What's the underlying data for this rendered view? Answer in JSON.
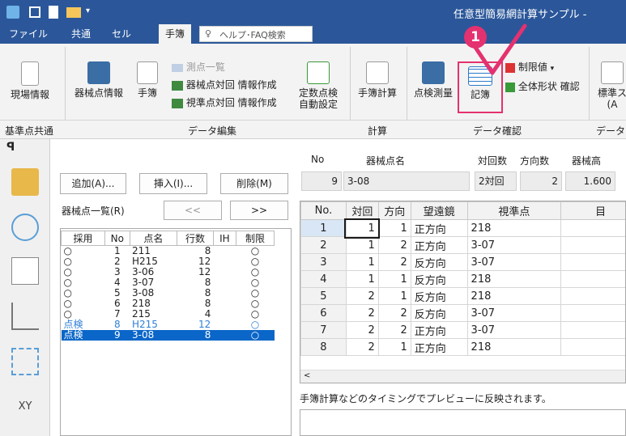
{
  "title": "任意型簡易網計算サンプル -",
  "tabs": [
    "ファイル",
    "共通",
    "セル",
    "手簿"
  ],
  "help_search": "ヘルプ･FAQ検索",
  "ribbon": {
    "genba": "現場情報",
    "kikaiten_info": "器械点情報",
    "tebo_menu": "手簿",
    "sokuten_list": "測点一覧",
    "kikai_taikai": "器械点対回 情報作成",
    "shijun_taikai": "視準点対回 情報作成",
    "teisu": "定数点検",
    "jido": "自動設定",
    "tebo_keisan": "手簿計算",
    "tenken_sokuryo": "点検測量",
    "kibo": "記簿",
    "seigenchi": "制限値",
    "zentai": "全体形状 確認",
    "hyojun_1": "標準ス",
    "hyojun_2": "(A",
    "grp_kijun": "基準点共通",
    "grp_data_edit": "データ編集",
    "grp_keisan": "計算",
    "grp_data_kakunin": "データ確認",
    "grp_data_cut": "データ",
    "callout_number": "1"
  },
  "actions": {
    "add": "追加(A)...",
    "insert": "挿入(I)...",
    "delete": "削除(M)",
    "prev": "<<",
    "next": ">>"
  },
  "list": {
    "title": "器械点一覧(R)",
    "headers": [
      "採用",
      "No",
      "点名",
      "行数",
      "IH",
      "制限"
    ],
    "rows": [
      [
        "○",
        "1",
        "211",
        "8",
        "",
        "○"
      ],
      [
        "○",
        "2",
        "H215",
        "12",
        "",
        "○"
      ],
      [
        "○",
        "3",
        "3-06",
        "12",
        "",
        "○"
      ],
      [
        "○",
        "4",
        "3-07",
        "8",
        "",
        "○"
      ],
      [
        "○",
        "5",
        "3-08",
        "8",
        "",
        "○"
      ],
      [
        "○",
        "6",
        "218",
        "8",
        "",
        "○"
      ],
      [
        "○",
        "7",
        "215",
        "4",
        "",
        "○"
      ],
      [
        "点検",
        "8",
        "H215",
        "12",
        "",
        "○"
      ],
      [
        "点検",
        "9",
        "3-08",
        "8",
        "",
        "○"
      ]
    ]
  },
  "info": {
    "lbl_no": "No",
    "lbl_name": "器械点名",
    "lbl_taikai": "対回数",
    "lbl_hoko": "方向数",
    "lbl_kikaidaka": "器械高",
    "no": "9",
    "name": "3-08",
    "taikai": "2対回",
    "hoko": "2",
    "kikaidaka": "1.600"
  },
  "grid": {
    "headers": [
      "No.",
      "対回",
      "方向",
      "望遠鏡",
      "視準点",
      "目"
    ],
    "rows": [
      [
        "1",
        "1",
        "1",
        "正方向",
        "218"
      ],
      [
        "2",
        "1",
        "2",
        "正方向",
        "3-07"
      ],
      [
        "3",
        "1",
        "2",
        "反方向",
        "3-07"
      ],
      [
        "4",
        "1",
        "1",
        "反方向",
        "218"
      ],
      [
        "5",
        "2",
        "1",
        "反方向",
        "218"
      ],
      [
        "6",
        "2",
        "2",
        "反方向",
        "3-07"
      ],
      [
        "7",
        "2",
        "2",
        "正方向",
        "3-07"
      ],
      [
        "8",
        "2",
        "1",
        "正方向",
        "218"
      ]
    ]
  },
  "note": "手簿計算などのタイミングでプレビューに反映されます。",
  "colors": {
    "accent": "#2b579a",
    "callout": "#e4316f",
    "selection": "#0a66c8"
  }
}
